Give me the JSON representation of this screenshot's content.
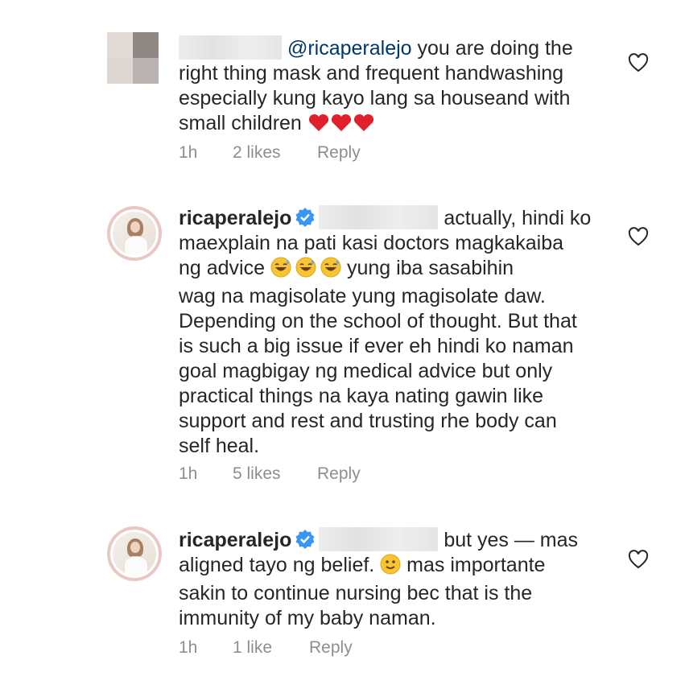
{
  "comments": [
    {
      "mention": "@ricaperalejo",
      "lines": [
        "you are doing the",
        "right thing mask and frequent handwashing",
        "especially kung kayo lang sa houseand with",
        "small children"
      ],
      "time": "1h",
      "likes": "2 likes",
      "reply": "Reply"
    },
    {
      "username": "ricaperalejo",
      "lines": [
        "actually, hindi ko",
        "maexplain na pati kasi doctors magkakaiba",
        "ng advice",
        "yung iba sasabihin",
        "wag na magisolate yung magisolate daw.",
        "Depending on the school of thought. But that",
        "is such a big issue if ever eh hindi ko naman",
        "goal magbigay ng medical advice but only",
        "practical things na kaya nating gawin like",
        "support and rest and trusting rhe body can",
        "self heal."
      ],
      "time": "1h",
      "likes": "5 likes",
      "reply": "Reply"
    },
    {
      "username": "ricaperalejo",
      "lines": [
        "but yes — mas",
        "aligned tayo ng belief.",
        "mas importante",
        "sakin to continue nursing bec that is the",
        "immunity of my baby naman."
      ],
      "time": "1h",
      "likes": "1 like",
      "reply": "Reply"
    }
  ],
  "icons": {
    "heart": "heart-outline-icon",
    "verified": "verified-badge-icon",
    "hearts_red": "red-heart-emoji",
    "laugh": "sweat-smile-emoji",
    "smile": "slight-smile-emoji"
  },
  "colors": {
    "text": "#262626",
    "meta": "#8e8e8e",
    "mention": "#00376b",
    "verified": "#3897f0",
    "heart_red": "#e0202b"
  }
}
